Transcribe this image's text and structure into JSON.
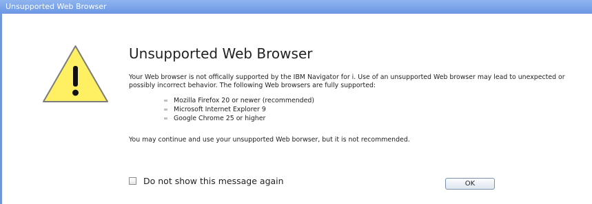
{
  "window": {
    "title": "Unsupported Web Browser"
  },
  "icon": {
    "name": "warning-icon",
    "fill": "#ffef63",
    "stroke": "#7b7b7b"
  },
  "message": {
    "heading": "Unsupported Web Browser",
    "intro": "Your Web browser is not offically supported by the IBM Navigator for i. Use of an unsupported Web browser may lead to unexpected or possibly incorrect behavior. The following Web browsers are fully supported:",
    "browsers": [
      "Mozilla Firefox 20 or newer (recommended)",
      "Microsoft Internet Explorer 9",
      "Google Chrome 25 or higher"
    ],
    "note": "You may continue and use your unsupported Web borwser, but it is not recommended."
  },
  "footer": {
    "checkbox_label": "Do not show this message again",
    "checkbox_checked": false,
    "ok_label": "OK"
  },
  "colors": {
    "titlebar": "#6b97e4",
    "accent": "#6f97d9"
  }
}
